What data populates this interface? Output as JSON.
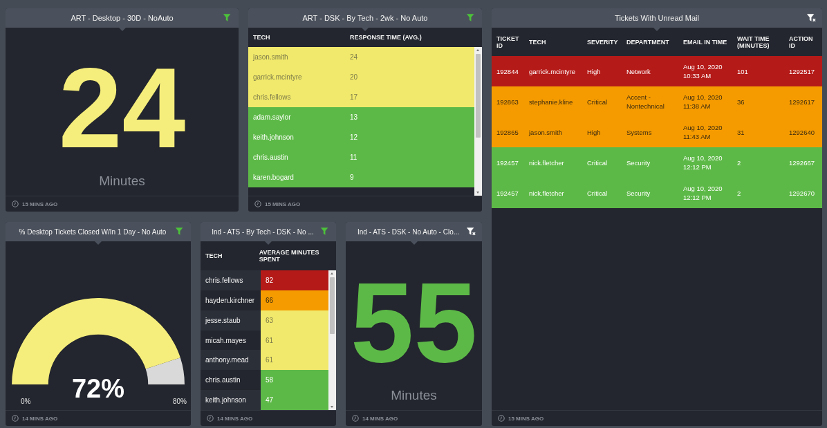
{
  "top_row": [
    {
      "kind": "number",
      "title": "ART - Desktop - 30D - NoAuto",
      "filtered": true,
      "value": "24",
      "color": "#f6ee7c",
      "unit": "Minutes",
      "updated": "15 MINS AGO"
    },
    {
      "kind": "row_table",
      "title": "ART - DSK - By Tech - 2wk - No Auto",
      "filtered": true,
      "columns": [
        "TECH",
        "RESPONSE TIME (AVG.)"
      ],
      "rows": [
        {
          "cells": [
            "jason.smith",
            "24"
          ],
          "color": "#f0e96b"
        },
        {
          "cells": [
            "garrick.mcintyre",
            "20"
          ],
          "color": "#f0e96b"
        },
        {
          "cells": [
            "chris.fellows",
            "17"
          ],
          "color": "#f0e96b"
        },
        {
          "cells": [
            "adam.saylor",
            "13"
          ],
          "color": "#5db947"
        },
        {
          "cells": [
            "keith.johnson",
            "12"
          ],
          "color": "#5db947"
        },
        {
          "cells": [
            "chris.austin",
            "11"
          ],
          "color": "#5db947"
        },
        {
          "cells": [
            "karen.bogard",
            "9"
          ],
          "color": "#5db947"
        }
      ],
      "updated": "15 MINS AGO"
    }
  ],
  "mail_panel": {
    "kind": "row_table",
    "title": "Tickets With Unread Mail",
    "filtered": false,
    "columns": [
      "TICKET ID",
      "TECH",
      "SEVERITY",
      "DEPARTMENT",
      "EMAIL IN TIME",
      "WAIT TIME (MINUTES)",
      "ACTION ID"
    ],
    "rows": [
      {
        "cells": [
          "192844",
          "garrick.mcintyre",
          "High",
          "Network",
          "Aug 10, 2020 10:33 AM",
          "101",
          "1292517"
        ],
        "color": "#b41a18"
      },
      {
        "cells": [
          "192863",
          "stephanie.kline",
          "Critical",
          "Accent - Nontechnical",
          "Aug 10, 2020 11:38 AM",
          "36",
          "1292617"
        ],
        "color": "#f59b00"
      },
      {
        "cells": [
          "192865",
          "jason.smith",
          "High",
          "Systems",
          "Aug 10, 2020 11:43 AM",
          "31",
          "1292640"
        ],
        "color": "#f59b00"
      },
      {
        "cells": [
          "192457",
          "nick.fletcher",
          "Critical",
          "Security",
          "Aug 10, 2020 12:12 PM",
          "2",
          "1292667"
        ],
        "color": "#5db947"
      },
      {
        "cells": [
          "192457",
          "nick.fletcher",
          "Critical",
          "Security",
          "Aug 10, 2020 12:12 PM",
          "2",
          "1292670"
        ],
        "color": "#5db947"
      }
    ],
    "updated": "15 MINS AGO"
  },
  "bottom_row": [
    {
      "kind": "gauge",
      "title": "% Desktop Tickets Closed W/In 1 Day - No Auto",
      "filtered": true,
      "value": "72%",
      "min_label": "0%",
      "max_label": "80%",
      "updated": "14 MINS AGO"
    },
    {
      "kind": "cell_table",
      "title": "Ind - ATS - By Tech - DSK - No ...",
      "filtered": true,
      "columns": [
        "TECH",
        "AVERAGE MINUTES SPENT"
      ],
      "rows": [
        {
          "cells": [
            "chris.fellows",
            "82"
          ],
          "color": "#b41a18"
        },
        {
          "cells": [
            "hayden.kirchner",
            "66"
          ],
          "color": "#f59b00"
        },
        {
          "cells": [
            "jesse.staub",
            "63"
          ],
          "color": "#f0e96b"
        },
        {
          "cells": [
            "micah.mayes",
            "61"
          ],
          "color": "#f0e96b"
        },
        {
          "cells": [
            "anthony.mead",
            "61"
          ],
          "color": "#f0e96b"
        },
        {
          "cells": [
            "chris.austin",
            "58"
          ],
          "color": "#5db947"
        },
        {
          "cells": [
            "keith.johnson",
            "47"
          ],
          "color": "#5db947"
        }
      ],
      "updated": "14 MINS AGO"
    },
    {
      "kind": "number",
      "title": "Ind - ATS - DSK - No Auto - Clo...",
      "filtered": false,
      "value": "55",
      "color": "#5db947",
      "unit": "Minutes",
      "updated": "14 MINS AGO"
    }
  ]
}
